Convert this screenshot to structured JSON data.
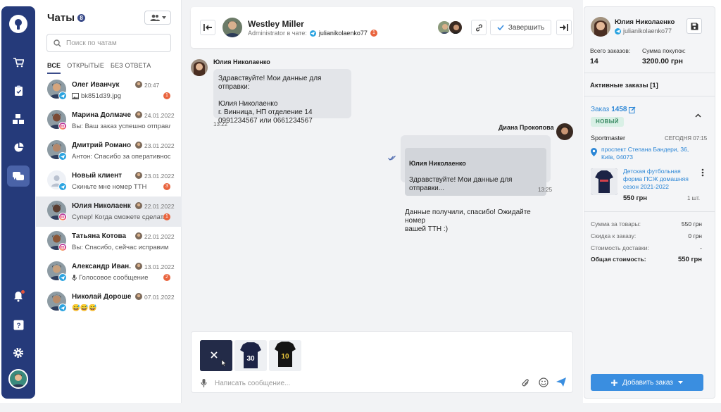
{
  "sidebar": {
    "icons": [
      "cart-icon",
      "clipboard-icon",
      "boxes-icon",
      "pie-chart-icon",
      "chat-icon",
      "bell-icon",
      "help-icon",
      "gear-icon"
    ]
  },
  "chats": {
    "title": "Чаты",
    "count": "8",
    "search_placeholder": "Поиск по чатам",
    "tabs": [
      "ВСЕ",
      "ОТКРЫТЫЕ",
      "БЕЗ ОТВЕТА"
    ],
    "items": [
      {
        "name": "Олег Иванчук",
        "preview": "bk851d39.jpg",
        "date": "20:47",
        "unread": "1",
        "channel": "telegram",
        "color": "#d6a57c"
      },
      {
        "name": "Марина Долмаче...",
        "preview": "Вы: Ваш заказ успешно отправле...",
        "date": "24.01.2022",
        "unread": "",
        "channel": "instagram",
        "color": "#7a4a35"
      },
      {
        "name": "Дмитрий Романов",
        "preview": "Антон: Спасибо за оперативност...",
        "date": "23.01.2022",
        "unread": "",
        "channel": "telegram",
        "color": "#b4876a"
      },
      {
        "name": "Новый клиент",
        "preview": "Скиньте мне номер ТТН",
        "date": "23.01.2022",
        "unread": "3",
        "channel": "telegram",
        "color": "#dfe3ea"
      },
      {
        "name": "Юлия Николаенко",
        "preview": "Супер! Когда сможете сделат...",
        "date": "22.01.2022",
        "unread": "1",
        "channel": "instagram",
        "color": "#5a3d30"
      },
      {
        "name": "Татьяна Котова",
        "preview": "Вы: Спасибо, сейчас исправим",
        "date": "22.01.2022",
        "unread": "",
        "channel": "instagram",
        "color": "#8a5637"
      },
      {
        "name": "Александр Иван...",
        "preview": "Голосовое сообщение",
        "date": "13.01.2022",
        "unread": "2",
        "channel": "telegram",
        "color": "#c7a07d"
      },
      {
        "name": "Николай Дорошен...",
        "preview": "😅😅😅",
        "date": "07.01.2022",
        "unread": "",
        "channel": "telegram",
        "color": "#b88c6b"
      }
    ]
  },
  "conversation": {
    "header": {
      "name": "Westley Miller",
      "role": "Administrator в чате:",
      "handle": "julianikolaenko77",
      "badge": "1",
      "finish": "Завершить"
    },
    "messages": [
      {
        "sender": "Юлия Николаенко",
        "text": "Здравствуйте! Мои данные для отправки:\n\nЮлия Николаенко\nг. Винница, НП отделение 14\n0991234567 или 0661234567",
        "time": "13:22"
      },
      {
        "sender": "Диана Прокопова",
        "quote_name": "Юлия Николаенко",
        "quote_text": "Здравствуйте! Мои данные для отправки...",
        "text": "Данные получили, спасибо! Ожидайте номер\nвашей ТТН :)",
        "time": "13:25"
      }
    ],
    "input_placeholder": "Написать сообщение...",
    "attachments": [
      "30",
      "10"
    ]
  },
  "customer": {
    "name": "Юлия Николаенко",
    "handle": "julianikolaenko77",
    "orders_label": "Всего заказов:",
    "orders": "14",
    "sum_label": "Сумма покупок:",
    "sum": "3200.00 грн",
    "active_title": "Активные заказы [1]",
    "order": {
      "label": "Заказ",
      "number": "1458",
      "status": "НОВЫЙ",
      "shop": "Sportmaster",
      "when": "СЕГОДНЯ 07:15",
      "address": "проспект Степана Бандери, 36, Київ, 04073",
      "product": "Детская футбольная форма ПСЖ домашняя сезон 2021-2022",
      "price": "550 грн",
      "qty": "1 шт."
    },
    "totals": [
      {
        "label": "Сумма за товары:",
        "value": "550 грн"
      },
      {
        "label": "Скидка к заказу:",
        "value": "0 грн"
      },
      {
        "label": "Стоимость доставки:",
        "value": "-"
      }
    ],
    "total_label": "Общая стоимость:",
    "total": "550 грн",
    "add_order": "Добавить заказ"
  }
}
